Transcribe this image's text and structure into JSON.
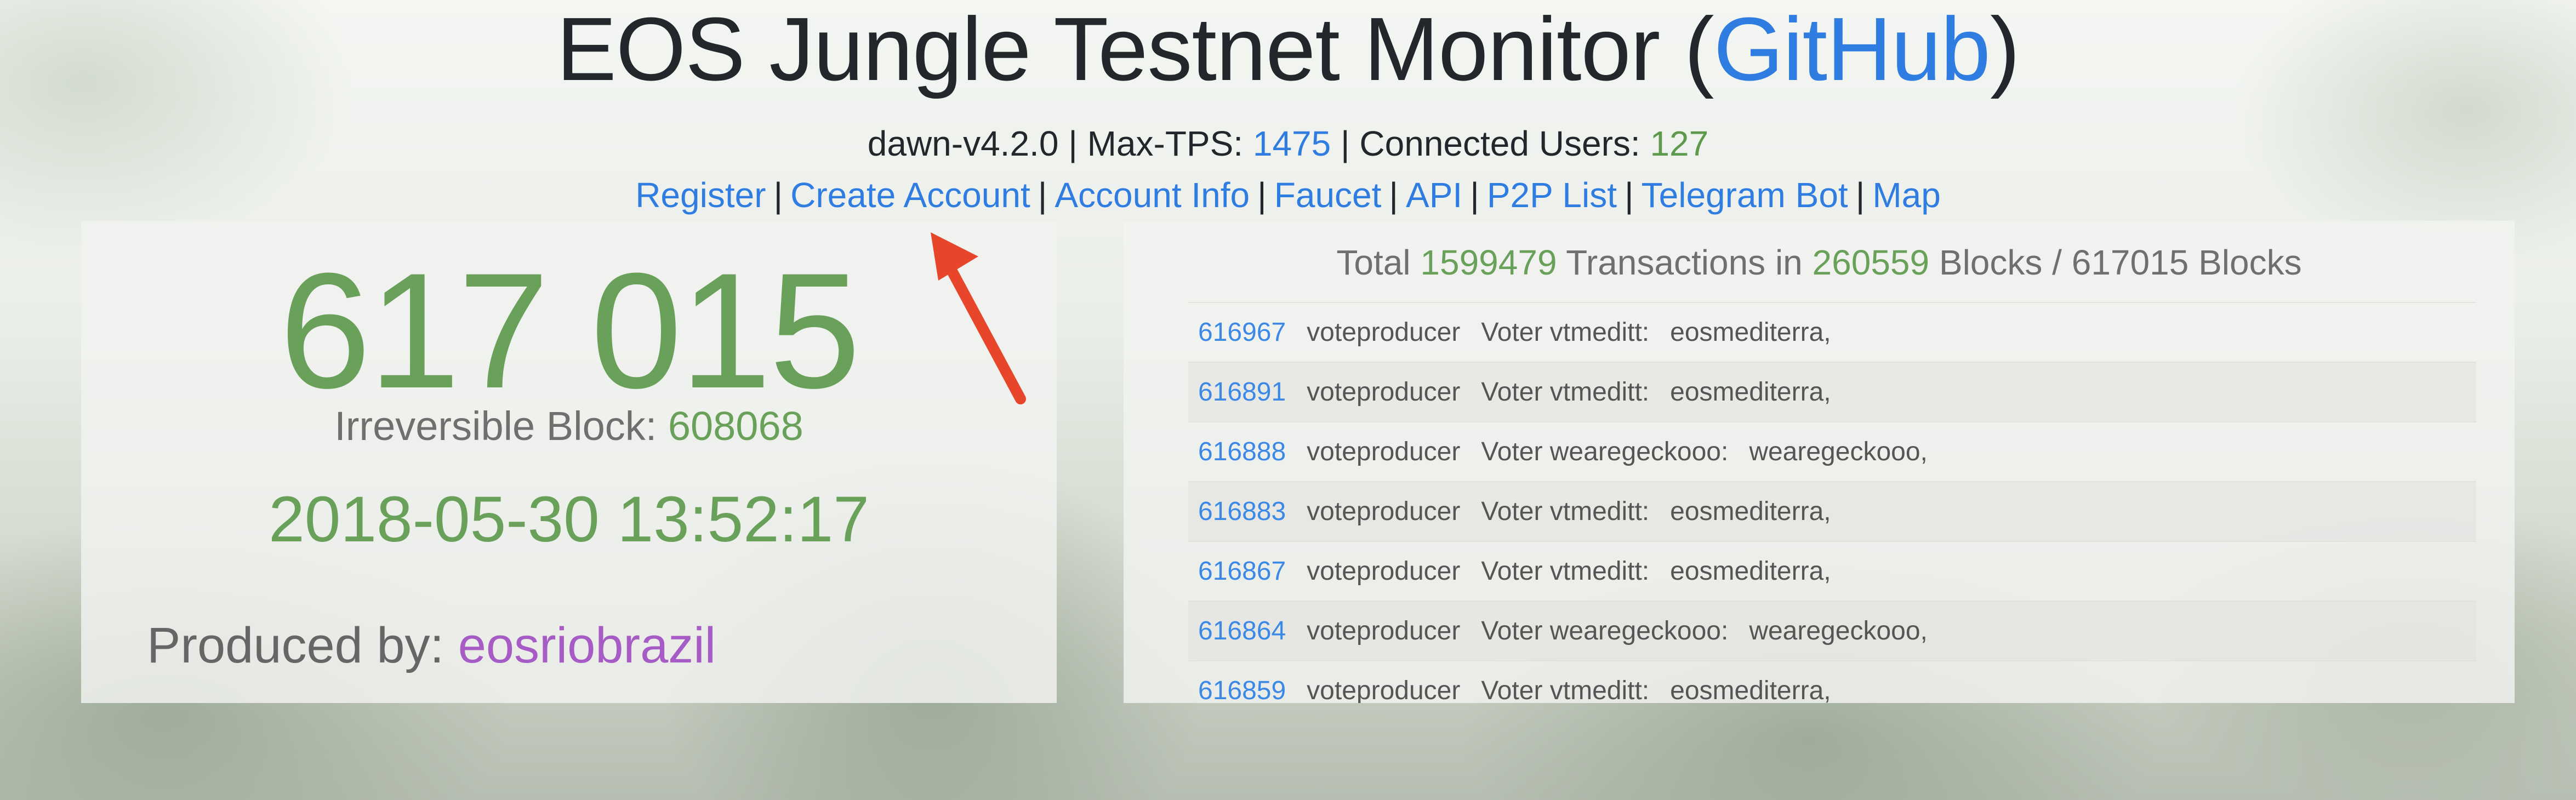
{
  "header": {
    "title": "EOS Jungle Testnet Monitor (",
    "github_label": "GitHub",
    "title_close": ")"
  },
  "status": {
    "version": "dawn-v4.2.0",
    "sep1": " | ",
    "max_tps_label": "Max-TPS: ",
    "max_tps": "1475",
    "sep2": " | ",
    "users_label": "Connected Users: ",
    "users": "127"
  },
  "nav": [
    "Register",
    "Create Account",
    "Account Info",
    "Faucet",
    "API",
    "P2P List",
    "Telegram Bot",
    "Map"
  ],
  "nav_separator": "|",
  "block": {
    "number": "617 015",
    "irreversible_label": "Irreversible Block: ",
    "irreversible": "608068",
    "timestamp": "2018-05-30 13:52:17",
    "produced_label": "Produced by: ",
    "producer": "eosriobrazil"
  },
  "summary": {
    "prefix": "Total ",
    "transactions": "1599479",
    "mid": " Transactions in ",
    "blocks": "260559",
    "suffix": " Blocks / 617015 Blocks"
  },
  "transactions": [
    {
      "block": "616967",
      "action": "voteproducer",
      "voter": "Voter vtmeditt:",
      "producers": "eosmediterra,"
    },
    {
      "block": "616891",
      "action": "voteproducer",
      "voter": "Voter vtmeditt:",
      "producers": "eosmediterra,"
    },
    {
      "block": "616888",
      "action": "voteproducer",
      "voter": "Voter wearegeckooo:",
      "producers": "wearegeckooo,"
    },
    {
      "block": "616883",
      "action": "voteproducer",
      "voter": "Voter vtmeditt:",
      "producers": "eosmediterra,"
    },
    {
      "block": "616867",
      "action": "voteproducer",
      "voter": "Voter vtmeditt:",
      "producers": "eosmediterra,"
    },
    {
      "block": "616864",
      "action": "voteproducer",
      "voter": "Voter wearegeckooo:",
      "producers": "wearegeckooo,"
    },
    {
      "block": "616859",
      "action": "voteproducer",
      "voter": "Voter vtmeditt:",
      "producers": "eosmediterra,"
    }
  ],
  "colors": {
    "link": "#2f7de1",
    "green": "#6aa15a",
    "purple": "#a65cc4",
    "arrow": "#e8462a"
  }
}
